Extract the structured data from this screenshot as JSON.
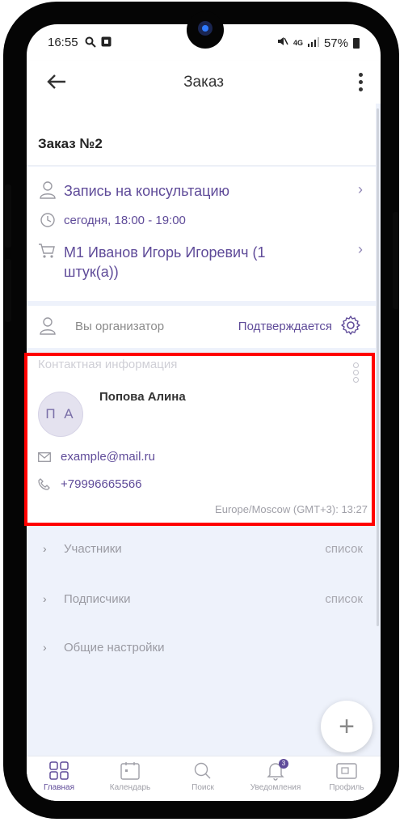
{
  "status_bar": {
    "time": "16:55",
    "network": "4G",
    "battery": "57%"
  },
  "app_bar": {
    "title": "Заказ"
  },
  "order": {
    "heading": "Заказ №2",
    "service": "Запись на консультацию",
    "time": "сегодня, 18:00 - 19:00",
    "product": "М1 Иванов Игорь Игоревич (1 штук(а))"
  },
  "organizer": {
    "label": "Вы организатор",
    "status": "Подтверждается"
  },
  "contact": {
    "section_title": "Контактная информация",
    "initials": "П А",
    "name": "Попова Алина",
    "email": "example@mail.ru",
    "phone": "+79996665566",
    "timezone": "Europe/Moscow (GMT+3): 13:27"
  },
  "sections": [
    {
      "name": "Участники",
      "value": "список"
    },
    {
      "name": "Подписчики",
      "value": "список"
    },
    {
      "name": "Общие настройки",
      "value": ""
    }
  ],
  "fab": {
    "label": "+"
  },
  "tabs": [
    {
      "label": "Главная",
      "icon": "grid-icon",
      "active": true
    },
    {
      "label": "Календарь",
      "icon": "calendar-icon",
      "active": false
    },
    {
      "label": "Поиск",
      "icon": "search-icon",
      "active": false
    },
    {
      "label": "Уведомления",
      "icon": "bell-icon",
      "active": false,
      "badge": "3"
    },
    {
      "label": "Профиль",
      "icon": "profile-icon",
      "active": false
    }
  ],
  "colors": {
    "accent": "#5f4b99",
    "highlight": "#ff0000",
    "background": "#eef2fb"
  }
}
